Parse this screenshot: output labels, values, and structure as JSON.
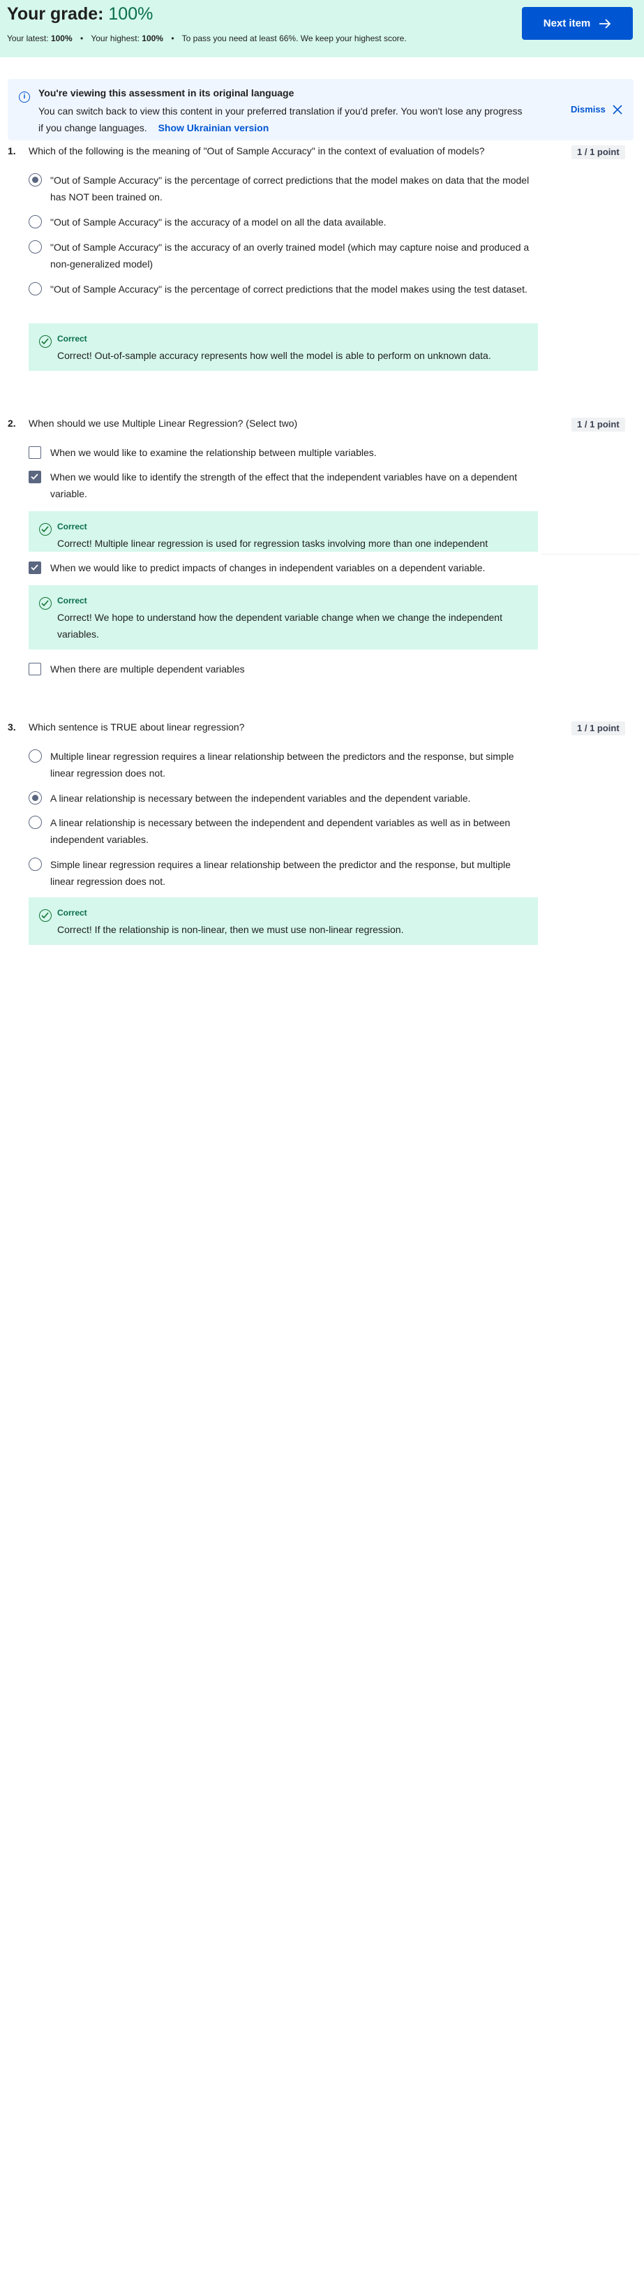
{
  "header": {
    "grade_label": "Your grade:",
    "grade_value": "100%",
    "latest_label": "Your latest:",
    "latest_value": "100%",
    "highest_label": "Your highest:",
    "highest_value": "100%",
    "pass_note": "To pass you need at least 66%. We keep your highest score.",
    "next_button": "Next item",
    "accent_color": "#0056d2",
    "banner_color": "#d5f7ec"
  },
  "notice": {
    "heading": "You're viewing this assessment in its original language",
    "body": "You can switch back to view this content in your preferred translation if you'd prefer. You won't lose any progress if you change languages.",
    "link": "Show Ukrainian version",
    "dismiss": "Dismiss"
  },
  "questions": [
    {
      "number": "1.",
      "text": "Which of the following is the meaning of \"Out of Sample Accuracy\" in the context of evaluation of models?",
      "points": "1 / 1 point",
      "options": [
        "\"Out of Sample Accuracy\" is the percentage of correct predictions that the model makes on data that the model has NOT been trained on.",
        "\"Out of Sample Accuracy\" is the accuracy of a model on all the data available.",
        "\"Out of Sample Accuracy\" is the accuracy of an overly trained model (which may capture noise and produced a non-generalized model)",
        "\"Out of Sample Accuracy\" is the percentage of correct predictions that the model makes using the test dataset."
      ],
      "feedback_label": "Correct",
      "feedback_text": "Correct! Out-of-sample accuracy represents how well the model is able to perform on unknown data."
    },
    {
      "number": "2.",
      "text": "When should we use Multiple Linear Regression? (Select two)",
      "points": "1 / 1 point",
      "options": [
        "When we would like to examine the relationship between multiple variables.",
        "When we would like to identify the strength of the effect that the independent variables have on a dependent variable.",
        "When we would like to predict impacts of changes in independent variables on a dependent variable.",
        "When there are multiple dependent variables"
      ],
      "feedback_1_label": "Correct",
      "feedback_1_text": "Correct! Multiple linear regression is used for regression tasks involving more than one independent",
      "feedback_2_label": "Correct",
      "feedback_2_text": "Correct! We hope to understand how the dependent variable change when we change the independent variables."
    },
    {
      "number": "3.",
      "text": "Which sentence is TRUE about linear regression?",
      "points": "1 / 1 point",
      "options": [
        "Multiple linear regression requires a linear relationship between the predictors and the response, but simple linear regression does not.",
        "A linear relationship is necessary between the independent variables and the dependent variable.",
        "A linear relationship is necessary between the independent and dependent variables as well as in between independent variables.",
        "Simple linear regression requires a linear relationship between the predictor and the response, but multiple linear regression does not."
      ],
      "feedback_label": "Correct",
      "feedback_text": "Correct! If the relationship is non-linear, then we must use non-linear regression."
    }
  ]
}
